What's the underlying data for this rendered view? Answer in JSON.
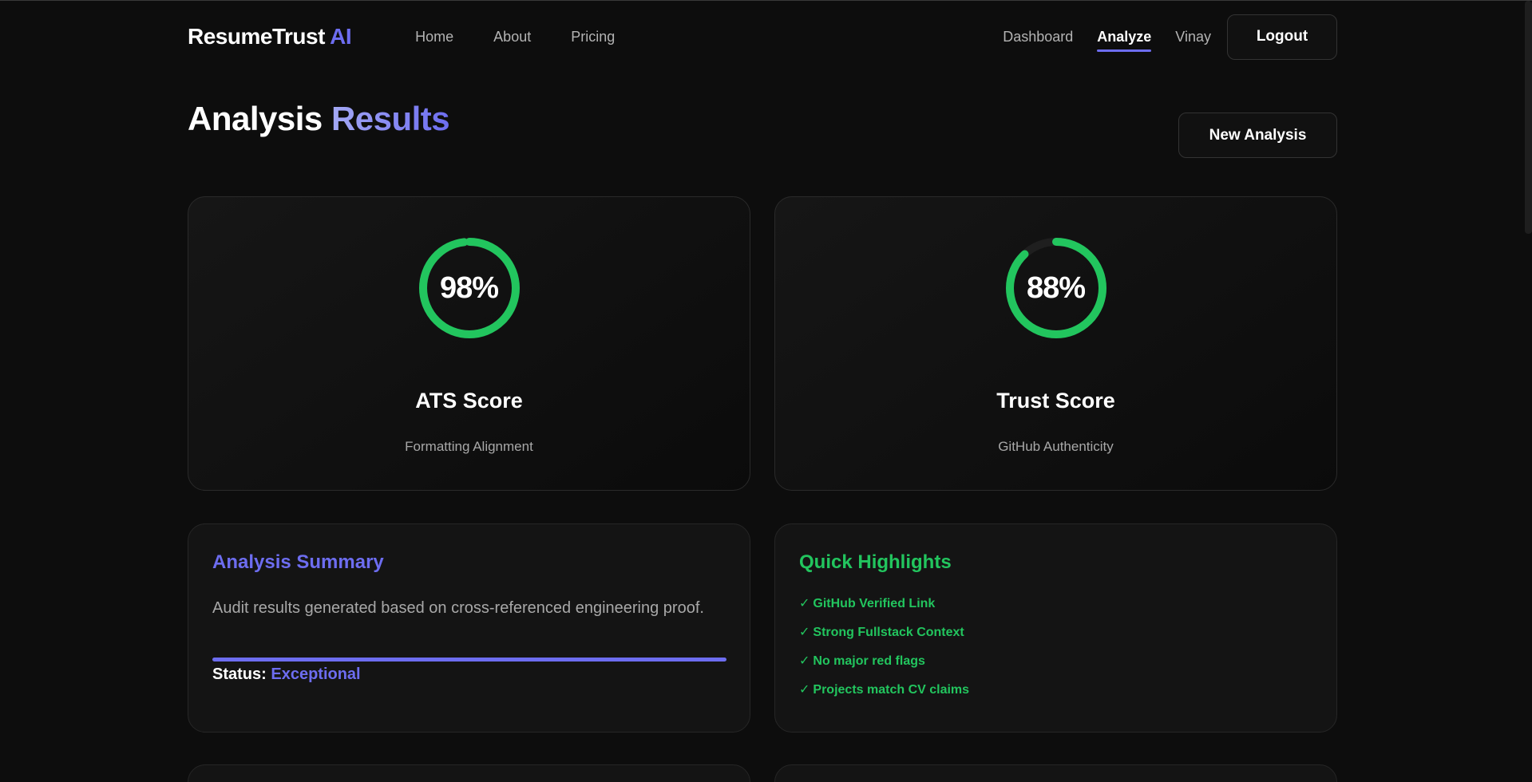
{
  "nav": {
    "logo_main": "ResumeTrust",
    "logo_accent": "AI",
    "links": [
      {
        "label": "Home"
      },
      {
        "label": "About"
      },
      {
        "label": "Pricing"
      }
    ],
    "right_links": [
      {
        "label": "Dashboard"
      },
      {
        "label": "Analyze",
        "active": true
      },
      {
        "label": "Vinay"
      }
    ],
    "logout_label": "Logout"
  },
  "header": {
    "title_part1": "Analysis",
    "title_part2": "Results",
    "new_analysis_label": "New Analysis"
  },
  "scores": {
    "ats": {
      "value_text": "98%",
      "value": 98,
      "label": "ATS Score",
      "sub": "Formatting Alignment",
      "color": "#22c55e"
    },
    "trust": {
      "value_text": "88%",
      "value": 88,
      "label": "Trust Score",
      "sub": "GitHub Authenticity",
      "color": "#22c55e"
    }
  },
  "summary": {
    "title": "Analysis Summary",
    "text": "Audit results generated based on cross-referenced engineering proof.",
    "status_label": "Status:",
    "status_value": "Exceptional",
    "progress": 100
  },
  "highlights": {
    "title": "Quick Highlights",
    "check_glyph": "✓",
    "items": [
      "GitHub Verified Link",
      "Strong Fullstack Context",
      "No major red flags",
      "Projects match CV claims"
    ]
  },
  "colors": {
    "accent": "#6d6df0",
    "success": "#22c55e",
    "background": "#0d0d0d"
  }
}
